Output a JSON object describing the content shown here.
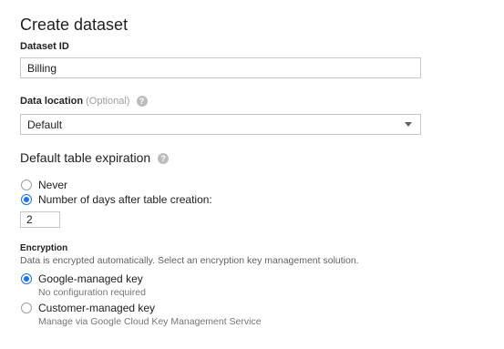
{
  "form": {
    "title": "Create dataset",
    "dataset_id": {
      "label": "Dataset ID",
      "value": "Billing"
    },
    "data_location": {
      "label": "Data location",
      "optional_text": "(Optional)",
      "selected": "Default"
    },
    "expiration": {
      "heading": "Default table expiration",
      "options": [
        {
          "label": "Never",
          "selected": false
        },
        {
          "label": "Number of days after table creation:",
          "selected": true
        }
      ],
      "days_value": "2"
    },
    "encryption": {
      "label": "Encryption",
      "description": "Data is encrypted automatically. Select an encryption key management solution.",
      "options": [
        {
          "label": "Google-managed key",
          "sub": "No configuration required",
          "selected": true
        },
        {
          "label": "Customer-managed key",
          "sub": "Manage via Google Cloud Key Management Service",
          "selected": false
        }
      ]
    }
  },
  "colors": {
    "accent": "#1a73e8",
    "border": "#c4c7c5",
    "muted_text": "#757575"
  },
  "icons": {
    "help": "help-icon",
    "dropdown": "chevron-down-icon"
  }
}
